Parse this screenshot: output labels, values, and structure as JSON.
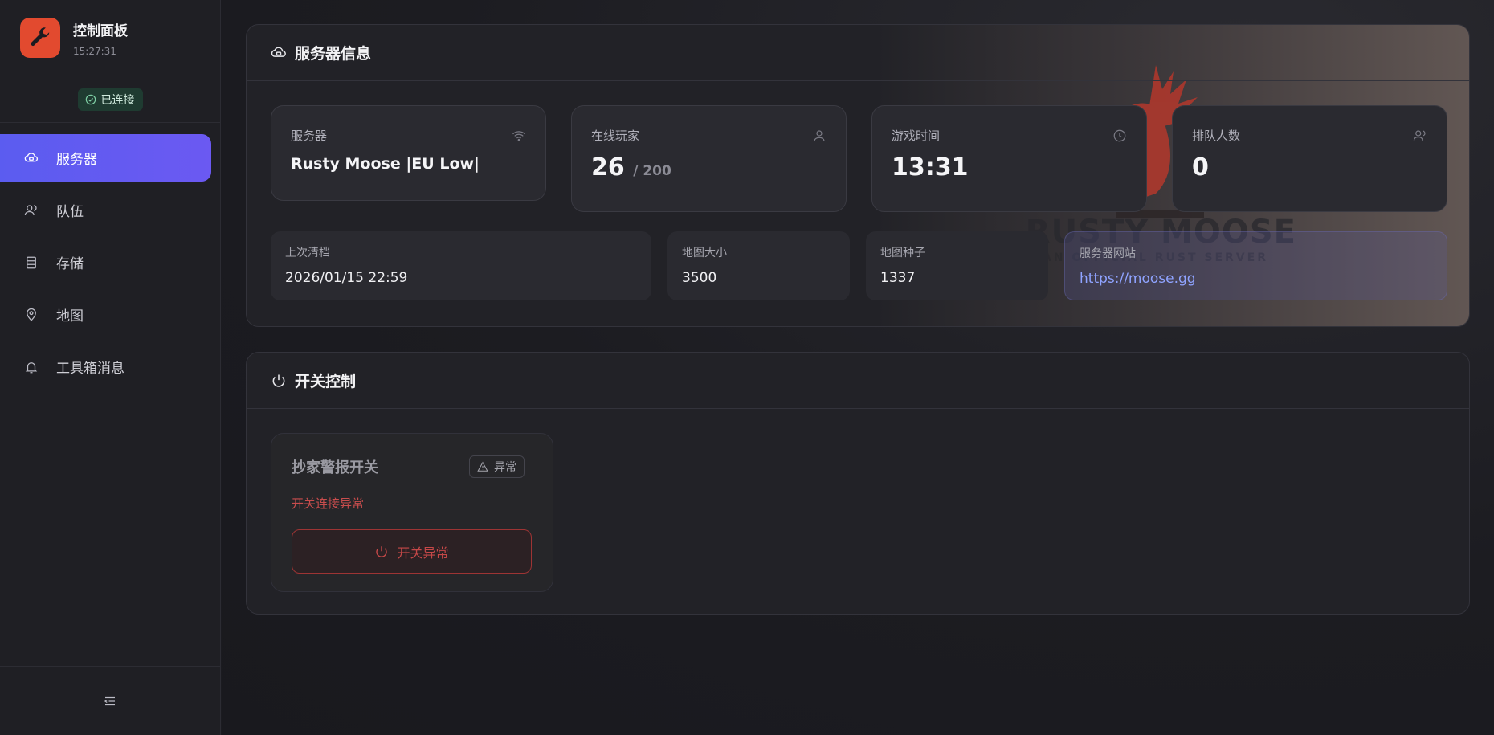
{
  "brand": {
    "title": "控制面板",
    "time": "15:27:31"
  },
  "status": {
    "label": "已连接"
  },
  "sidebar": {
    "items": [
      {
        "label": "服务器",
        "icon": "cloud-icon",
        "active": true
      },
      {
        "label": "队伍",
        "icon": "users-icon",
        "active": false
      },
      {
        "label": "存储",
        "icon": "storage-icon",
        "active": false
      },
      {
        "label": "地图",
        "icon": "map-pin-icon",
        "active": false
      },
      {
        "label": "工具箱消息",
        "icon": "bell-icon",
        "active": false
      }
    ]
  },
  "server_info": {
    "title": "服务器信息",
    "banner": {
      "logo_text": "RUSTY MOOSE",
      "logo_sub": "AN OFFICIAL RUST SERVER"
    },
    "stats": {
      "server": {
        "label": "服务器",
        "value": "Rusty Moose |EU Low|"
      },
      "players": {
        "label": "在线玩家",
        "value": "26",
        "max": "/ 200"
      },
      "game_time": {
        "label": "游戏时间",
        "value": "13:31"
      },
      "queue": {
        "label": "排队人数",
        "value": "0"
      }
    },
    "details": {
      "last_wipe": {
        "label": "上次清档",
        "value": "2026/01/15 22:59"
      },
      "map_size": {
        "label": "地图大小",
        "value": "3500"
      },
      "map_seed": {
        "label": "地图种子",
        "value": "1337"
      },
      "website": {
        "label": "服务器网站",
        "value": "https://moose.gg"
      }
    }
  },
  "switch_control": {
    "title": "开关控制",
    "switch": {
      "name": "抄家警报开关",
      "badge": "异常",
      "error": "开关连接异常",
      "button": "开关异常"
    }
  },
  "colors": {
    "accent": "#5b5cf0",
    "brand": "#e24a2f",
    "connected": "#1f3b31",
    "error": "#c94d4d",
    "link": "#8fa3ff"
  }
}
